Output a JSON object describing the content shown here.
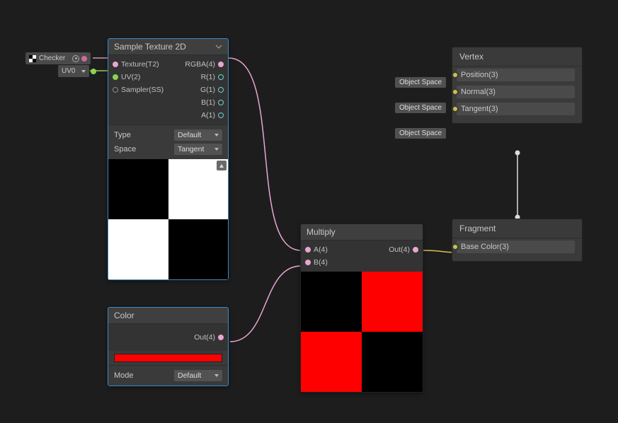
{
  "sampleTexture": {
    "title": "Sample Texture 2D",
    "inputs": {
      "texture": "Texture(T2)",
      "uv": "UV(2)",
      "sampler": "Sampler(SS)"
    },
    "outputs": {
      "rgba": "RGBA(4)",
      "r": "R(1)",
      "g": "G(1)",
      "b": "B(1)",
      "a": "A(1)"
    },
    "params": {
      "typeLabel": "Type",
      "typeValue": "Default",
      "spaceLabel": "Space",
      "spaceValue": "Tangent"
    }
  },
  "colorNode": {
    "title": "Color",
    "output": "Out(4)",
    "modeLabel": "Mode",
    "modeValue": "Default",
    "color": "#ff0000"
  },
  "multiply": {
    "title": "Multiply",
    "inA": "A(4)",
    "inB": "B(4)",
    "out": "Out(4)"
  },
  "vertex": {
    "title": "Vertex",
    "rows": [
      {
        "tag": "Object Space",
        "name": "Position(3)"
      },
      {
        "tag": "Object Space",
        "name": "Normal(3)"
      },
      {
        "tag": "Object Space",
        "name": "Tangent(3)"
      }
    ]
  },
  "fragment": {
    "title": "Fragment",
    "row": {
      "name": "Base Color(3)"
    }
  },
  "externals": {
    "checker": "Checker",
    "uv0": "UV0"
  }
}
